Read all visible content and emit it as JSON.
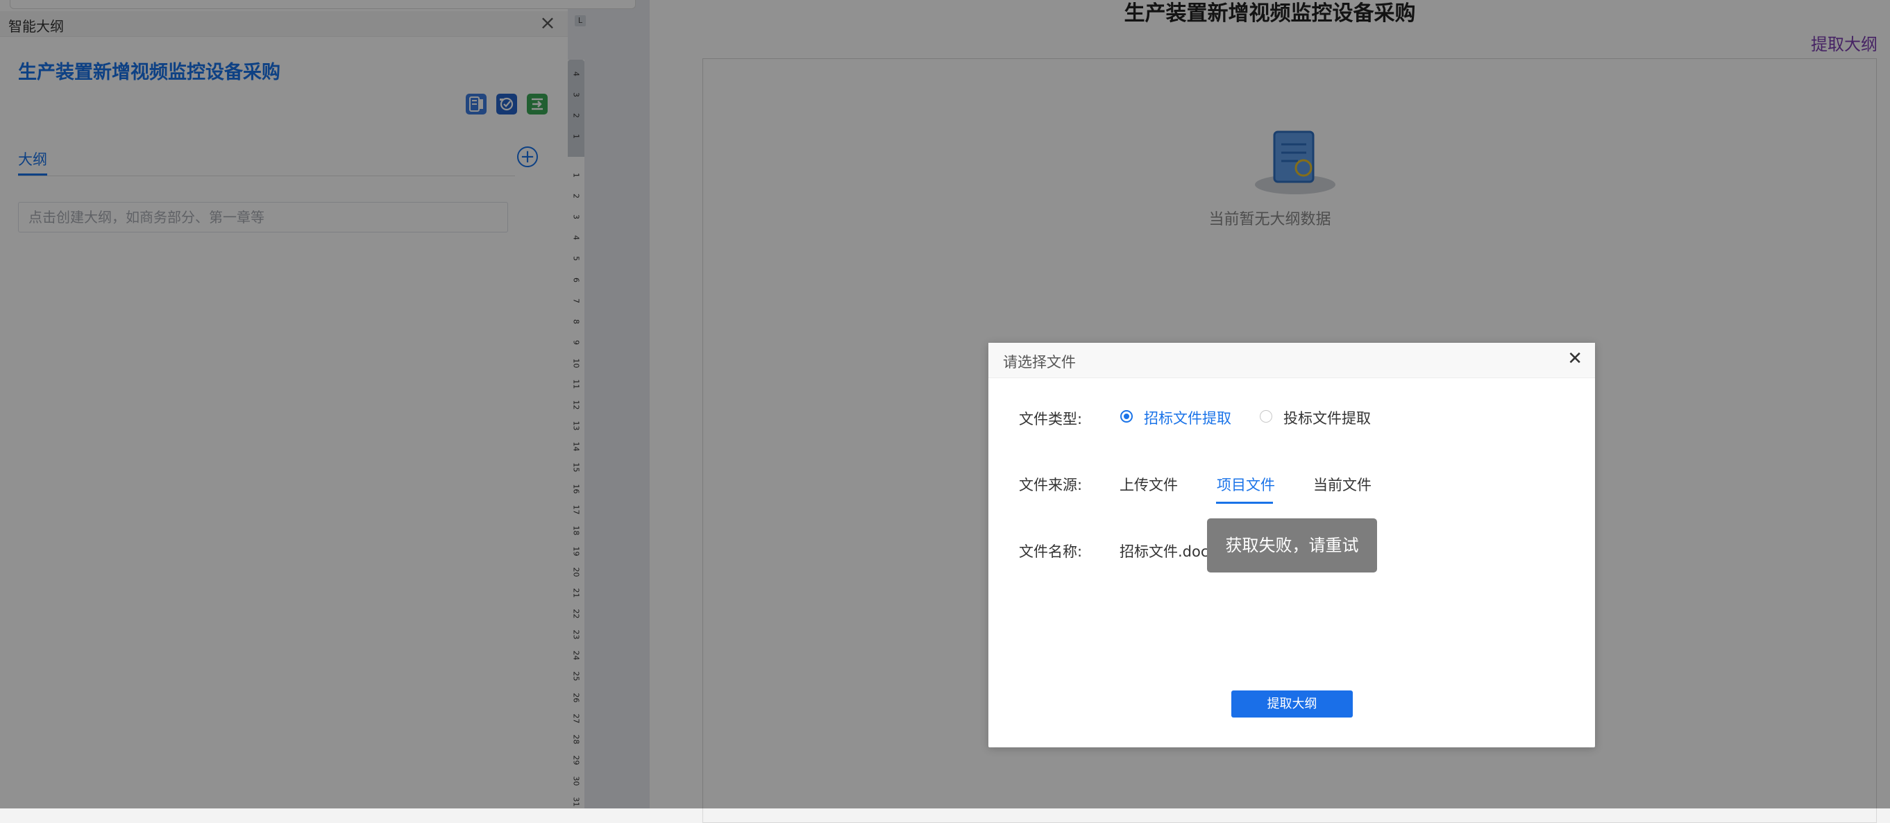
{
  "sidebar": {
    "window_title": "智能大纲",
    "close_icon": "close-icon",
    "document_title": "生产装置新增视频监控设备采购",
    "toolbar_icons": [
      "outline-doc-icon",
      "ai-icon",
      "export-icon"
    ],
    "tab_label": "大纲",
    "add_icon": "plus-circle-icon",
    "outline_input_placeholder": "点击创建大纲，如商务部分、第一章等"
  },
  "ruler": {
    "corner_mark": "L",
    "top_numbers": [
      "4",
      "3",
      "2",
      "1"
    ],
    "numbers": [
      "1",
      "2",
      "3",
      "4",
      "5",
      "6",
      "7",
      "8",
      "9",
      "10",
      "11",
      "12",
      "13",
      "14",
      "15",
      "16",
      "17",
      "18",
      "19",
      "20",
      "21",
      "22",
      "23",
      "24",
      "25",
      "26",
      "27",
      "28",
      "29",
      "30",
      "31"
    ]
  },
  "main": {
    "title": "生产装置新增视频监控设备采购",
    "extract_link": "提取大纲",
    "empty_text": "当前暂无大纲数据"
  },
  "modal": {
    "title": "请选择文件",
    "close_icon": "close-icon",
    "file_type_label": "文件类型:",
    "file_type_options": [
      "招标文件提取",
      "投标文件提取"
    ],
    "file_type_selected": "招标文件提取",
    "file_source_label": "文件来源:",
    "file_source_tabs": [
      "上传文件",
      "项目文件",
      "当前文件"
    ],
    "file_source_active": "项目文件",
    "file_name_label": "文件名称:",
    "file_name_value": "招标文件.docx",
    "extract_button": "提取大纲"
  },
  "toast": {
    "message": "获取失败，请重试"
  },
  "colors": {
    "accent": "#1a73e8",
    "link_purple": "#7b3fb0",
    "success_green": "#3aa757",
    "toast_bg": "#7d7d7d"
  }
}
